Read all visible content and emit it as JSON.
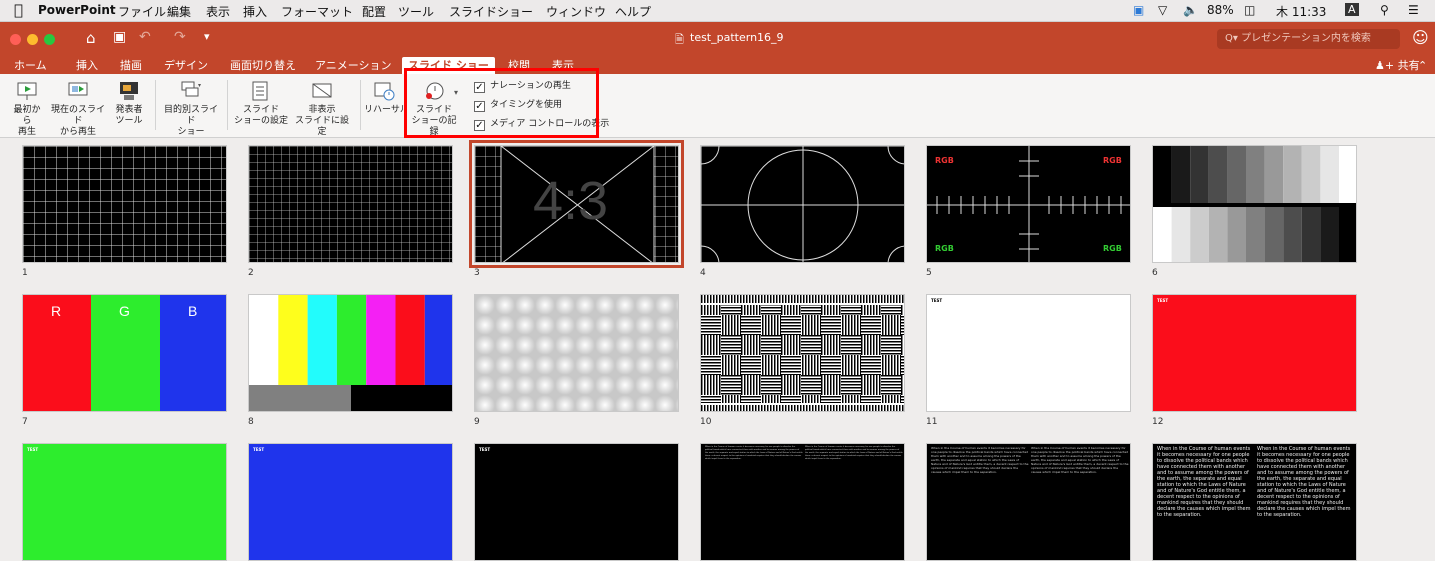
{
  "menubar": {
    "app_name": "PowerPoint",
    "items": [
      "ファイル",
      "編集",
      "表示",
      "挿入",
      "フォーマット",
      "配置",
      "ツール",
      "スライドショー",
      "ウィンドウ",
      "ヘルプ"
    ],
    "battery": "88%",
    "clock": "木 11:33",
    "input_mode": "A"
  },
  "window": {
    "title": "test_pattern16_9",
    "search_placeholder": "Q▾ プレゼンテーション内を検索"
  },
  "tabs": [
    "ホーム",
    "挿入",
    "描画",
    "デザイン",
    "画面切り替え",
    "アニメーション",
    "スライド ショー",
    "校閲",
    "表示"
  ],
  "active_tab": "スライド ショー",
  "share_label": "共有",
  "ribbon": {
    "from_start": [
      "最初から",
      "再生"
    ],
    "from_current": [
      "現在のスライド",
      "から再生"
    ],
    "presenter": [
      "発表者",
      "ツール"
    ],
    "custom": [
      "目的別スライド",
      "ショー"
    ],
    "setup": [
      "スライド",
      "ショーの設定"
    ],
    "hide": [
      "非表示",
      "スライドに設定"
    ],
    "rehearse": "リハーサル",
    "record": [
      "スライド",
      "ショーの記録"
    ],
    "checkboxes": [
      {
        "label": "ナレーションの再生",
        "checked": true
      },
      {
        "label": "タイミングを使用",
        "checked": true
      },
      {
        "label": "メディア コントロールの表示",
        "checked": true
      }
    ]
  },
  "slides": {
    "numbers": [
      "1",
      "2",
      "3",
      "4",
      "5",
      "6",
      "7",
      "8",
      "9",
      "10",
      "11",
      "12"
    ],
    "selected": "3",
    "aspect_text": "4:3",
    "rgb_r": "R",
    "rgb_g": "G",
    "rgb_b": "B",
    "rgb_label": "RGB",
    "test_label": "TEST",
    "body_text": "When in the Course of human events it becomes necessary for one people to dissolve the political bands which have connected them with another and to assume among the powers of the earth, the separate and equal station to which the Laws of Nature and of Nature's God entitle them, a decent respect to the opinions of mankind requires that they should declare the causes which impel them to the separation."
  },
  "colors": {
    "accent": "#c2462b",
    "highlight": "#ff0000"
  }
}
